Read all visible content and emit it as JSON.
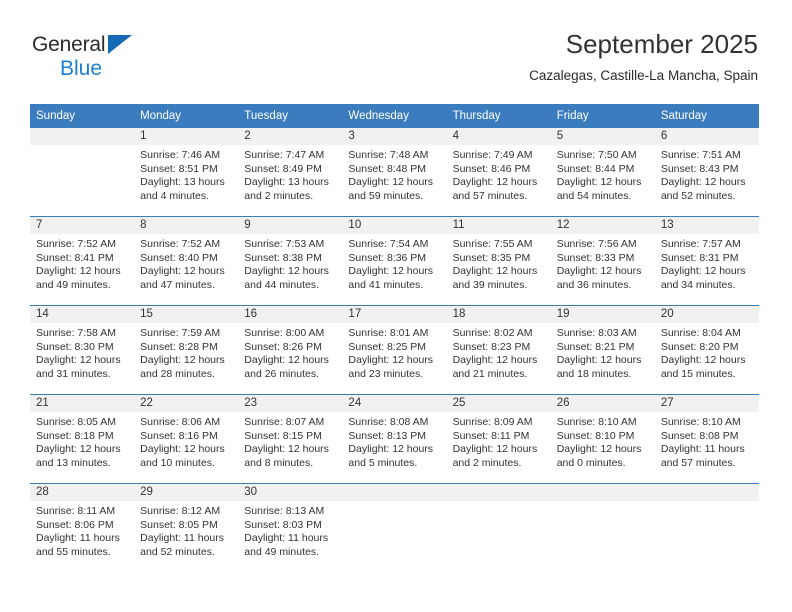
{
  "brand": {
    "name_top": "General",
    "name_bottom": "Blue",
    "accent_color": "#1b7fd4",
    "triangle_color": "#166ab5"
  },
  "header": {
    "title": "September 2025",
    "subtitle": "Cazalegas, Castille-La Mancha, Spain"
  },
  "calendar": {
    "header_bg": "#3a7cbe",
    "daynum_bg": "#f1f1f1",
    "weekday_headers": [
      "Sunday",
      "Monday",
      "Tuesday",
      "Wednesday",
      "Thursday",
      "Friday",
      "Saturday"
    ],
    "weeks": [
      [
        {
          "day": "",
          "blank": true,
          "sunrise": "",
          "sunset": "",
          "daylight1": "",
          "daylight2": ""
        },
        {
          "day": "1",
          "blank": false,
          "sunrise": "Sunrise: 7:46 AM",
          "sunset": "Sunset: 8:51 PM",
          "daylight1": "Daylight: 13 hours",
          "daylight2": "and 4 minutes."
        },
        {
          "day": "2",
          "blank": false,
          "sunrise": "Sunrise: 7:47 AM",
          "sunset": "Sunset: 8:49 PM",
          "daylight1": "Daylight: 13 hours",
          "daylight2": "and 2 minutes."
        },
        {
          "day": "3",
          "blank": false,
          "sunrise": "Sunrise: 7:48 AM",
          "sunset": "Sunset: 8:48 PM",
          "daylight1": "Daylight: 12 hours",
          "daylight2": "and 59 minutes."
        },
        {
          "day": "4",
          "blank": false,
          "sunrise": "Sunrise: 7:49 AM",
          "sunset": "Sunset: 8:46 PM",
          "daylight1": "Daylight: 12 hours",
          "daylight2": "and 57 minutes."
        },
        {
          "day": "5",
          "blank": false,
          "sunrise": "Sunrise: 7:50 AM",
          "sunset": "Sunset: 8:44 PM",
          "daylight1": "Daylight: 12 hours",
          "daylight2": "and 54 minutes."
        },
        {
          "day": "6",
          "blank": false,
          "sunrise": "Sunrise: 7:51 AM",
          "sunset": "Sunset: 8:43 PM",
          "daylight1": "Daylight: 12 hours",
          "daylight2": "and 52 minutes."
        }
      ],
      [
        {
          "day": "7",
          "blank": false,
          "sunrise": "Sunrise: 7:52 AM",
          "sunset": "Sunset: 8:41 PM",
          "daylight1": "Daylight: 12 hours",
          "daylight2": "and 49 minutes."
        },
        {
          "day": "8",
          "blank": false,
          "sunrise": "Sunrise: 7:52 AM",
          "sunset": "Sunset: 8:40 PM",
          "daylight1": "Daylight: 12 hours",
          "daylight2": "and 47 minutes."
        },
        {
          "day": "9",
          "blank": false,
          "sunrise": "Sunrise: 7:53 AM",
          "sunset": "Sunset: 8:38 PM",
          "daylight1": "Daylight: 12 hours",
          "daylight2": "and 44 minutes."
        },
        {
          "day": "10",
          "blank": false,
          "sunrise": "Sunrise: 7:54 AM",
          "sunset": "Sunset: 8:36 PM",
          "daylight1": "Daylight: 12 hours",
          "daylight2": "and 41 minutes."
        },
        {
          "day": "11",
          "blank": false,
          "sunrise": "Sunrise: 7:55 AM",
          "sunset": "Sunset: 8:35 PM",
          "daylight1": "Daylight: 12 hours",
          "daylight2": "and 39 minutes."
        },
        {
          "day": "12",
          "blank": false,
          "sunrise": "Sunrise: 7:56 AM",
          "sunset": "Sunset: 8:33 PM",
          "daylight1": "Daylight: 12 hours",
          "daylight2": "and 36 minutes."
        },
        {
          "day": "13",
          "blank": false,
          "sunrise": "Sunrise: 7:57 AM",
          "sunset": "Sunset: 8:31 PM",
          "daylight1": "Daylight: 12 hours",
          "daylight2": "and 34 minutes."
        }
      ],
      [
        {
          "day": "14",
          "blank": false,
          "sunrise": "Sunrise: 7:58 AM",
          "sunset": "Sunset: 8:30 PM",
          "daylight1": "Daylight: 12 hours",
          "daylight2": "and 31 minutes."
        },
        {
          "day": "15",
          "blank": false,
          "sunrise": "Sunrise: 7:59 AM",
          "sunset": "Sunset: 8:28 PM",
          "daylight1": "Daylight: 12 hours",
          "daylight2": "and 28 minutes."
        },
        {
          "day": "16",
          "blank": false,
          "sunrise": "Sunrise: 8:00 AM",
          "sunset": "Sunset: 8:26 PM",
          "daylight1": "Daylight: 12 hours",
          "daylight2": "and 26 minutes."
        },
        {
          "day": "17",
          "blank": false,
          "sunrise": "Sunrise: 8:01 AM",
          "sunset": "Sunset: 8:25 PM",
          "daylight1": "Daylight: 12 hours",
          "daylight2": "and 23 minutes."
        },
        {
          "day": "18",
          "blank": false,
          "sunrise": "Sunrise: 8:02 AM",
          "sunset": "Sunset: 8:23 PM",
          "daylight1": "Daylight: 12 hours",
          "daylight2": "and 21 minutes."
        },
        {
          "day": "19",
          "blank": false,
          "sunrise": "Sunrise: 8:03 AM",
          "sunset": "Sunset: 8:21 PM",
          "daylight1": "Daylight: 12 hours",
          "daylight2": "and 18 minutes."
        },
        {
          "day": "20",
          "blank": false,
          "sunrise": "Sunrise: 8:04 AM",
          "sunset": "Sunset: 8:20 PM",
          "daylight1": "Daylight: 12 hours",
          "daylight2": "and 15 minutes."
        }
      ],
      [
        {
          "day": "21",
          "blank": false,
          "sunrise": "Sunrise: 8:05 AM",
          "sunset": "Sunset: 8:18 PM",
          "daylight1": "Daylight: 12 hours",
          "daylight2": "and 13 minutes."
        },
        {
          "day": "22",
          "blank": false,
          "sunrise": "Sunrise: 8:06 AM",
          "sunset": "Sunset: 8:16 PM",
          "daylight1": "Daylight: 12 hours",
          "daylight2": "and 10 minutes."
        },
        {
          "day": "23",
          "blank": false,
          "sunrise": "Sunrise: 8:07 AM",
          "sunset": "Sunset: 8:15 PM",
          "daylight1": "Daylight: 12 hours",
          "daylight2": "and 8 minutes."
        },
        {
          "day": "24",
          "blank": false,
          "sunrise": "Sunrise: 8:08 AM",
          "sunset": "Sunset: 8:13 PM",
          "daylight1": "Daylight: 12 hours",
          "daylight2": "and 5 minutes."
        },
        {
          "day": "25",
          "blank": false,
          "sunrise": "Sunrise: 8:09 AM",
          "sunset": "Sunset: 8:11 PM",
          "daylight1": "Daylight: 12 hours",
          "daylight2": "and 2 minutes."
        },
        {
          "day": "26",
          "blank": false,
          "sunrise": "Sunrise: 8:10 AM",
          "sunset": "Sunset: 8:10 PM",
          "daylight1": "Daylight: 12 hours",
          "daylight2": "and 0 minutes."
        },
        {
          "day": "27",
          "blank": false,
          "sunrise": "Sunrise: 8:10 AM",
          "sunset": "Sunset: 8:08 PM",
          "daylight1": "Daylight: 11 hours",
          "daylight2": "and 57 minutes."
        }
      ],
      [
        {
          "day": "28",
          "blank": false,
          "sunrise": "Sunrise: 8:11 AM",
          "sunset": "Sunset: 8:06 PM",
          "daylight1": "Daylight: 11 hours",
          "daylight2": "and 55 minutes."
        },
        {
          "day": "29",
          "blank": false,
          "sunrise": "Sunrise: 8:12 AM",
          "sunset": "Sunset: 8:05 PM",
          "daylight1": "Daylight: 11 hours",
          "daylight2": "and 52 minutes."
        },
        {
          "day": "30",
          "blank": false,
          "sunrise": "Sunrise: 8:13 AM",
          "sunset": "Sunset: 8:03 PM",
          "daylight1": "Daylight: 11 hours",
          "daylight2": "and 49 minutes."
        },
        {
          "day": "",
          "blank": true,
          "sunrise": "",
          "sunset": "",
          "daylight1": "",
          "daylight2": ""
        },
        {
          "day": "",
          "blank": true,
          "sunrise": "",
          "sunset": "",
          "daylight1": "",
          "daylight2": ""
        },
        {
          "day": "",
          "blank": true,
          "sunrise": "",
          "sunset": "",
          "daylight1": "",
          "daylight2": ""
        },
        {
          "day": "",
          "blank": true,
          "sunrise": "",
          "sunset": "",
          "daylight1": "",
          "daylight2": ""
        }
      ]
    ]
  }
}
